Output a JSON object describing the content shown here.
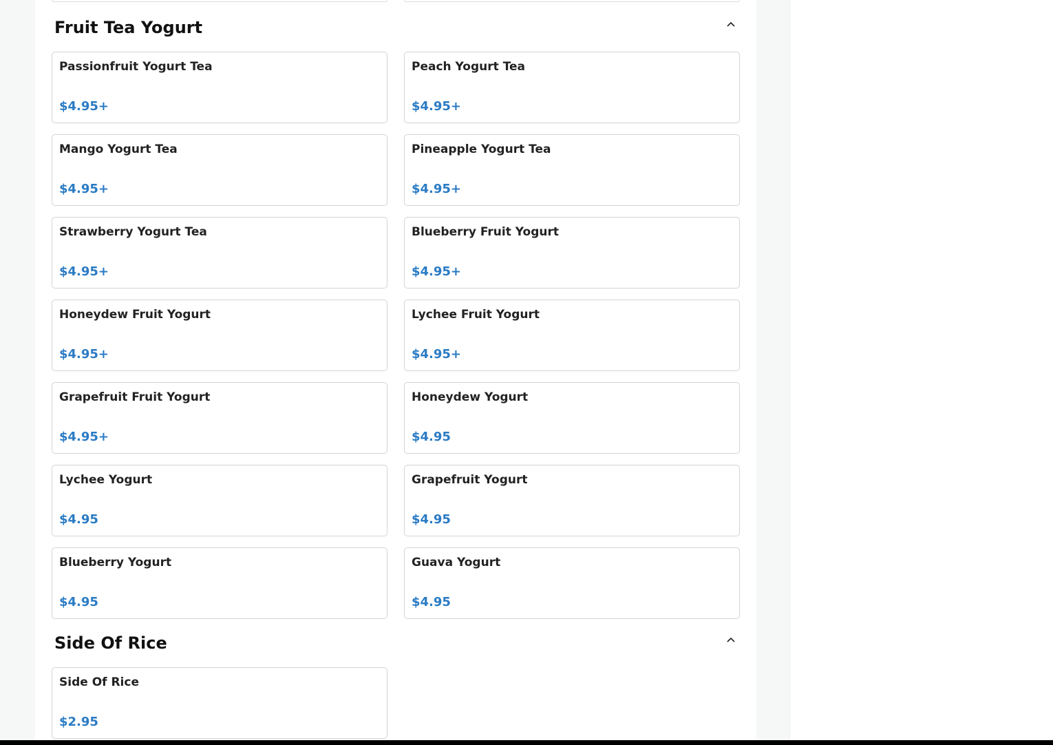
{
  "sections": [
    {
      "title": "Fruit Tea Yogurt",
      "items": [
        {
          "name": "Passionfruit Yogurt Tea",
          "price": "$4.95+"
        },
        {
          "name": "Peach Yogurt Tea",
          "price": "$4.95+"
        },
        {
          "name": "Mango Yogurt Tea",
          "price": "$4.95+"
        },
        {
          "name": "Pineapple Yogurt Tea",
          "price": "$4.95+"
        },
        {
          "name": "Strawberry Yogurt Tea",
          "price": "$4.95+"
        },
        {
          "name": "Blueberry Fruit Yogurt",
          "price": "$4.95+"
        },
        {
          "name": "Honeydew Fruit Yogurt",
          "price": "$4.95+"
        },
        {
          "name": "Lychee Fruit Yogurt",
          "price": "$4.95+"
        },
        {
          "name": "Grapefruit Fruit Yogurt",
          "price": "$4.95+"
        },
        {
          "name": "Honeydew Yogurt",
          "price": "$4.95"
        },
        {
          "name": "Lychee Yogurt",
          "price": "$4.95"
        },
        {
          "name": "Grapefruit Yogurt",
          "price": "$4.95"
        },
        {
          "name": "Blueberry Yogurt",
          "price": "$4.95"
        },
        {
          "name": "Guava Yogurt",
          "price": "$4.95"
        }
      ]
    },
    {
      "title": "Side Of Rice",
      "items": [
        {
          "name": "Side Of Rice",
          "price": "$2.95"
        }
      ]
    }
  ],
  "icons": {
    "collapse": "chevron-up-icon"
  },
  "colors": {
    "price": "#2a7bc4",
    "card_border": "#d4d4d4",
    "gutter": "#f6f7f7"
  }
}
